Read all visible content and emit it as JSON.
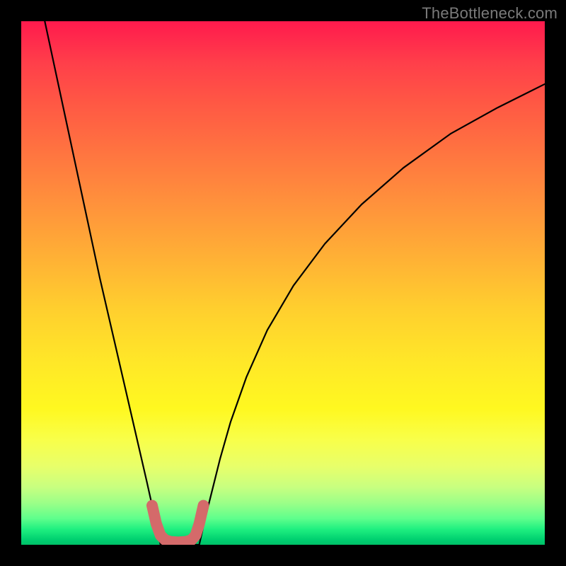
{
  "watermark": "TheBottleneck.com",
  "chart_data": {
    "type": "line",
    "title": "",
    "xlabel": "",
    "ylabel": "",
    "xlim": [
      0,
      1
    ],
    "ylim": [
      0,
      1
    ],
    "series": [
      {
        "name": "black-curve",
        "stroke": "#000000",
        "stroke_width": 2.2,
        "x": [
          0.045,
          0.06,
          0.075,
          0.09,
          0.105,
          0.12,
          0.135,
          0.15,
          0.165,
          0.18,
          0.195,
          0.21,
          0.225,
          0.24,
          0.25,
          0.26,
          0.266,
          0.34,
          0.35,
          0.365,
          0.38,
          0.4,
          0.43,
          0.47,
          0.52,
          0.58,
          0.65,
          0.73,
          0.82,
          0.91,
          1.0
        ],
        "y": [
          1.0,
          0.93,
          0.86,
          0.79,
          0.72,
          0.65,
          0.58,
          0.51,
          0.445,
          0.38,
          0.315,
          0.25,
          0.185,
          0.12,
          0.075,
          0.035,
          0.0,
          0.0,
          0.045,
          0.105,
          0.165,
          0.235,
          0.32,
          0.41,
          0.495,
          0.575,
          0.65,
          0.72,
          0.785,
          0.835,
          0.88
        ]
      },
      {
        "name": "red-trough",
        "stroke": "#d46a6a",
        "stroke_width": 16,
        "x": [
          0.25,
          0.258,
          0.266,
          0.275,
          0.285,
          0.3,
          0.315,
          0.325,
          0.333,
          0.34,
          0.348
        ],
        "y": [
          0.075,
          0.04,
          0.018,
          0.009,
          0.006,
          0.005,
          0.006,
          0.009,
          0.018,
          0.04,
          0.075
        ]
      }
    ],
    "background_gradient": {
      "stops": [
        {
          "pos": 0.0,
          "color": "#ff1a4d"
        },
        {
          "pos": 0.5,
          "color": "#ffcf2e"
        },
        {
          "pos": 0.8,
          "color": "#f8ff4a"
        },
        {
          "pos": 0.95,
          "color": "#5eff8c"
        },
        {
          "pos": 1.0,
          "color": "#00c068"
        }
      ]
    }
  }
}
